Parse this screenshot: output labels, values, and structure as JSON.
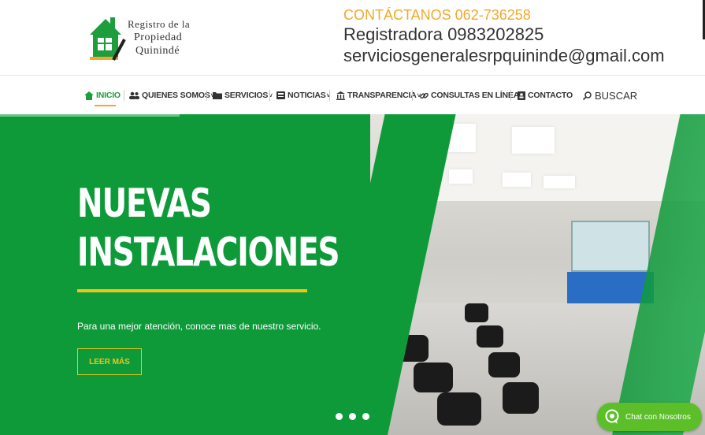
{
  "logo": {
    "line1": "Registro de la",
    "line2": "Propiedad",
    "line3": "Quinindé",
    "icon": "house-pen-logo"
  },
  "contact": {
    "title": "CONTÁCTANOS 062-736258",
    "line1": "Registradora 0983202825",
    "line2": "serviciosgeneralesrpquininde@gmail.com"
  },
  "nav": {
    "items": [
      {
        "label": "INICIO",
        "icon": "home-icon",
        "active": true
      },
      {
        "label": "QUIENES SOMOS",
        "icon": "users-icon",
        "caret": "˅"
      },
      {
        "label": "SERVICIOS",
        "icon": "folder-icon",
        "caret": "˅"
      },
      {
        "label": "NOTICIAS",
        "icon": "newspaper-icon",
        "caret": "˅"
      },
      {
        "label": "TRANSPARENCIA",
        "icon": "institution-icon",
        "caret": "˅"
      },
      {
        "label": "CONSULTAS EN LÍNEA",
        "icon": "link-icon",
        "caret": "˅"
      },
      {
        "label": "CONTACTO",
        "icon": "contact-card-icon"
      }
    ],
    "search_label": "BUSCAR"
  },
  "hero": {
    "title_line1": "NUEVAS",
    "title_line2": "INSTALACIONES",
    "subtitle": "Para una mejor atención, conoce mas de nuestro servicio.",
    "button": "LEER MÁS",
    "slides": 3
  },
  "chat": {
    "label": "Chat con Nosotros"
  },
  "colors": {
    "brand_green": "#0f9a3a",
    "accent_yellow": "#f0c419",
    "accent_orange": "#f0a92c",
    "chat_green": "#5cbf2a"
  }
}
